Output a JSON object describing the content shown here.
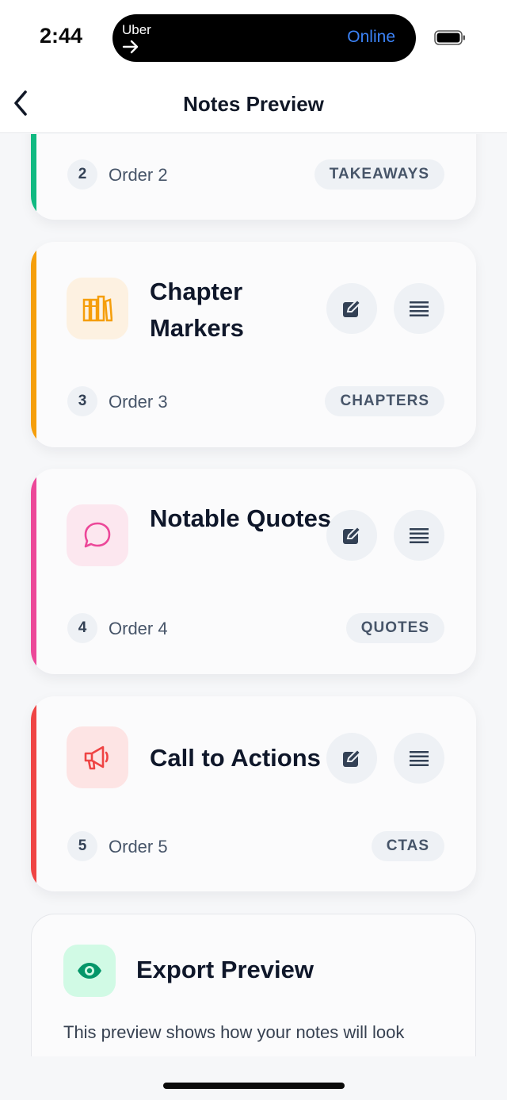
{
  "status_bar": {
    "time": "2:44",
    "island_app": "Uber",
    "island_status": "Online"
  },
  "nav": {
    "title": "Notes Preview"
  },
  "cards": [
    {
      "title": "",
      "order_number": "2",
      "order_label": "Order 2",
      "tag": "TAKEAWAYS",
      "accent": "#10b981"
    },
    {
      "title": "Chapter Markers",
      "order_number": "3",
      "order_label": "Order 3",
      "tag": "CHAPTERS",
      "accent": "#f59e0b",
      "icon": "books-icon",
      "icon_color": "#f59e0b",
      "tile_color": "#fdf1e1"
    },
    {
      "title": "Notable Quotes",
      "order_number": "4",
      "order_label": "Order 4",
      "tag": "QUOTES",
      "accent": "#ec4899",
      "icon": "speech-bubble-icon",
      "icon_color": "#ec4899",
      "tile_color": "#fce7ef"
    },
    {
      "title": "Call to Actions",
      "order_number": "5",
      "order_label": "Order 5",
      "tag": "CTAS",
      "accent": "#ef4444",
      "icon": "megaphone-icon",
      "icon_color": "#ef4444",
      "tile_color": "#fde4e4"
    }
  ],
  "export": {
    "title": "Export Preview",
    "description": "This preview shows how your notes will look",
    "icon": "eye-icon",
    "icon_color": "#059669"
  }
}
